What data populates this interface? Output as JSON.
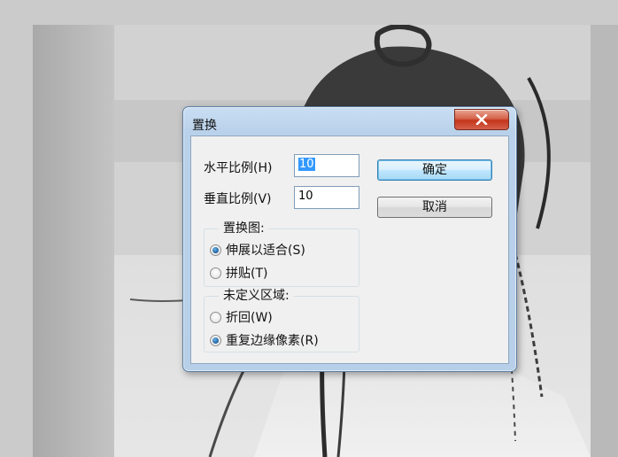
{
  "dialog": {
    "title": "置换",
    "close_icon": "close-icon"
  },
  "fields": {
    "horizontal_scale_label": "水平比例(H)",
    "horizontal_scale_value": "10",
    "vertical_scale_label": "垂直比例(V)",
    "vertical_scale_value": "10"
  },
  "buttons": {
    "ok_label": "确定",
    "cancel_label": "取消"
  },
  "displacement_map": {
    "title": "置换图:",
    "options": [
      {
        "label": "伸展以适合(S)",
        "checked": true
      },
      {
        "label": "拼贴(T)",
        "checked": false
      }
    ]
  },
  "undefined_areas": {
    "title": "未定义区域:",
    "options": [
      {
        "label": "折回(W)",
        "checked": false
      },
      {
        "label": "重复边缘像素(R)",
        "checked": true
      }
    ]
  },
  "colors": {
    "title_bar": "#b9d1ea",
    "close_button": "#c3351b",
    "default_button_border": "#3c7fb1",
    "selection": "#3399ff"
  }
}
